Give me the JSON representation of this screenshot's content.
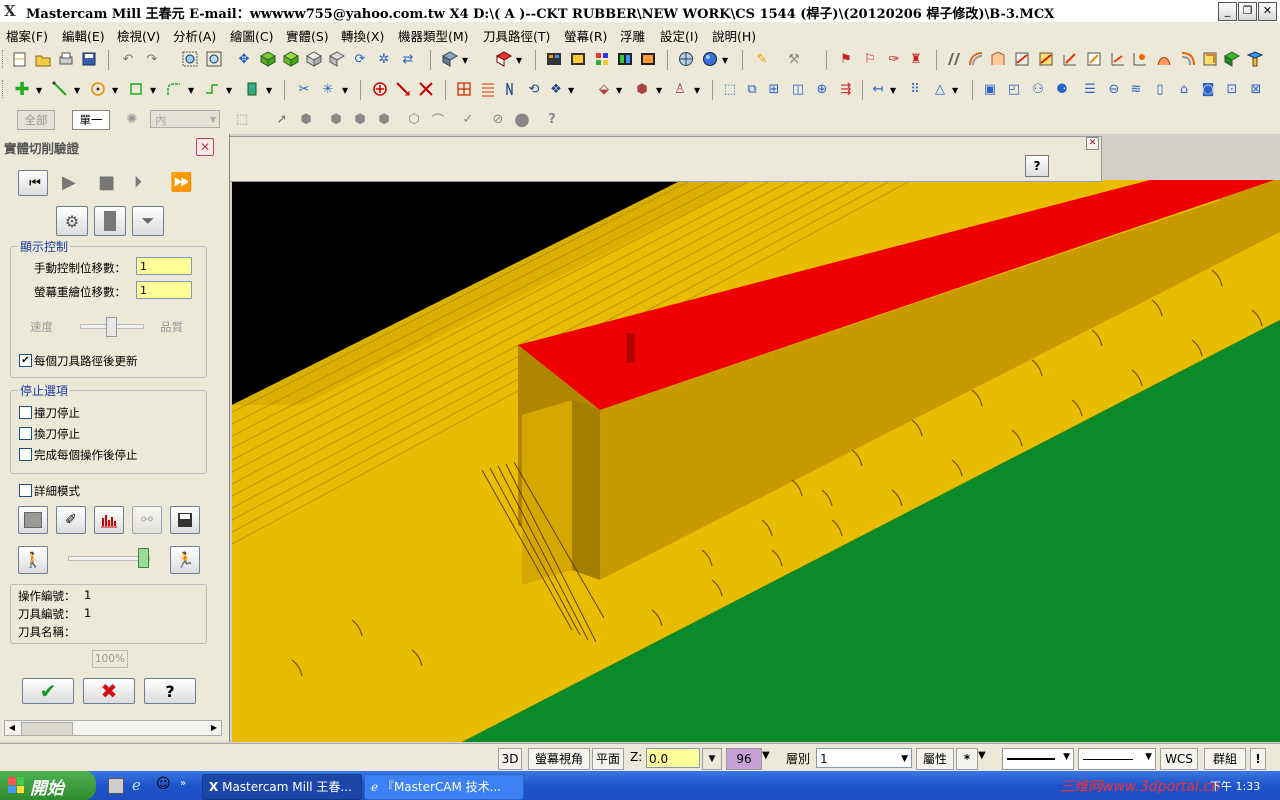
{
  "window": {
    "title": "Mastercam Mill 王春元 E-mail：wwwww755@yahoo.com.tw X4  D:\\( A )--CKT  RUBBER\\NEW WORK\\CS 1544 (桿子)\\(20120206 桿子修改)\\B-3.MCX",
    "min_label": "_",
    "max_label": "❐",
    "close_label": "✕"
  },
  "menu": [
    "檔案(F)",
    "編輯(E)",
    "檢視(V)",
    "分析(A)",
    "繪圖(C)",
    "實體(S)",
    "轉換(X)",
    "機器類型(M)",
    "刀具路徑(T)",
    "螢幕(R)",
    "浮雕",
    "設定(I)",
    "說明(H)"
  ],
  "toolbar3": {
    "all_label": "全部",
    "single_label": "單一",
    "inside_label": "內"
  },
  "panel": {
    "title": "實體切削驗證",
    "display_group": "顯示控制",
    "manual_step_label": "手動控制位移數：",
    "manual_step_value": "1",
    "redraw_step_label": "螢幕重繪位移數：",
    "redraw_step_value": "1",
    "speed_label": "速度",
    "quality_label": "品質",
    "update_each_label": "每個刀具路徑後更新",
    "update_each_checked": true,
    "stop_group": "停止選項",
    "stop_collision_label": "撞刀停止",
    "stop_tool_change_label": "換刀停止",
    "stop_after_op_label": "完成每個操作後停止",
    "detail_mode_label": "詳細模式",
    "op_number_label": "操作編號：",
    "op_number_value": "1",
    "tool_number_label": "刀具編號：",
    "tool_number_value": "1",
    "tool_name_label": "刀具名稱：",
    "tool_name_value": "",
    "percent": "100%",
    "ok_icon": "check-icon",
    "cancel_icon": "x-icon",
    "help_label": "?"
  },
  "status": {
    "mode_3d": "3D",
    "view_label": "螢幕視角",
    "plane_label": "平面",
    "z_label": "Z:",
    "z_value": "0.0",
    "color_value": "96",
    "layer_label": "層別",
    "layer_value": "1",
    "attr_label": "屬性",
    "point_style": "*",
    "wcs_label": "WCS",
    "group_label": "群組",
    "bang_label": "!"
  },
  "taskbar": {
    "start_label": "開始",
    "task1": "Mastercam Mill 王春...",
    "task2": "『MasterCAM 技术...",
    "tray_time": "下午 1:33",
    "watermark": "三维网www.3dportal.cn"
  },
  "colors": {
    "stock_yellow": "#e8bc00",
    "stock_shadow": "#c79a00",
    "cut_red": "#ee0000",
    "cut_green": "#0b8a2a",
    "viewport_bg": "#000000",
    "input_yellow": "#ffff99"
  }
}
